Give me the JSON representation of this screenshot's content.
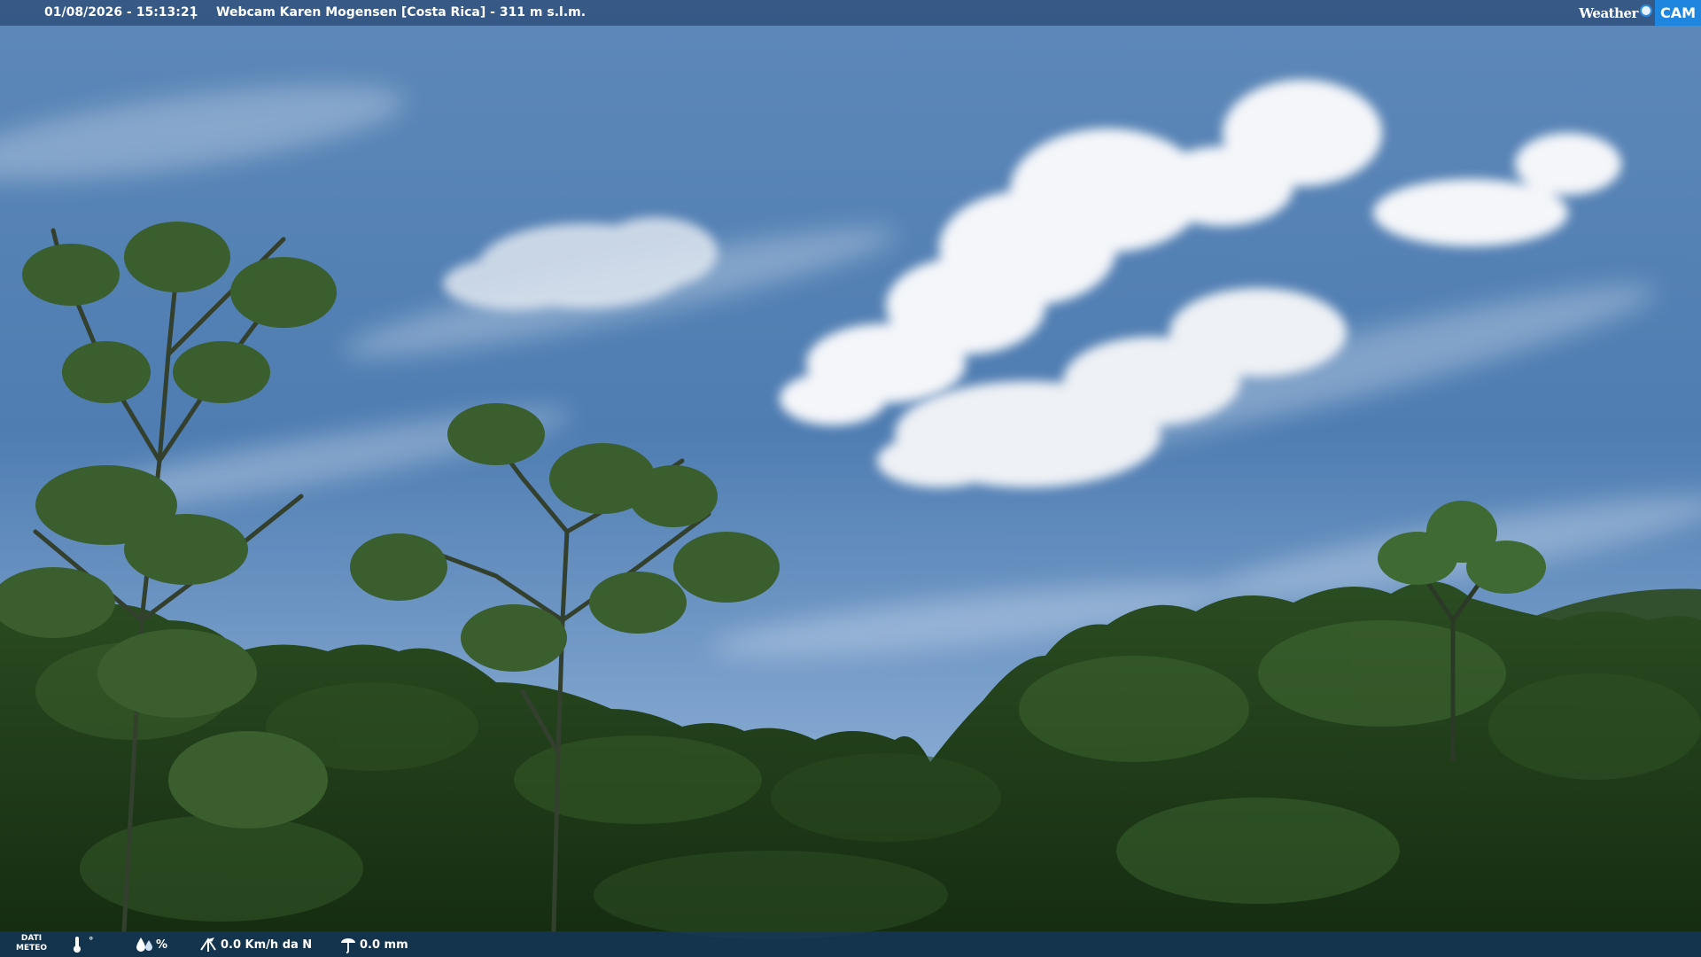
{
  "header": {
    "timestamp": "01/08/2026 - 15:13:21",
    "separator": "|",
    "title": "Webcam Karen Mogensen [Costa Rica]  - 311 m s.l.m.",
    "logo_word": "Weather",
    "logo_badge": "CAM"
  },
  "meteo": {
    "label_line1": "DATI",
    "label_line2": "METEO",
    "temperature_unit": "°",
    "humidity_unit": "%",
    "wind": "0.0 Km/h da N",
    "rain": "0.0 mm",
    "icons": [
      "thermometer-icon",
      "humidity-drops-icon",
      "wind-icon",
      "rain-gauge-icon"
    ]
  },
  "colors": {
    "sky_top": "#5b86b8",
    "sky_bottom": "#8fb0d6",
    "vegetation": "#1d3a16",
    "logo_blue": "#1e86de"
  }
}
